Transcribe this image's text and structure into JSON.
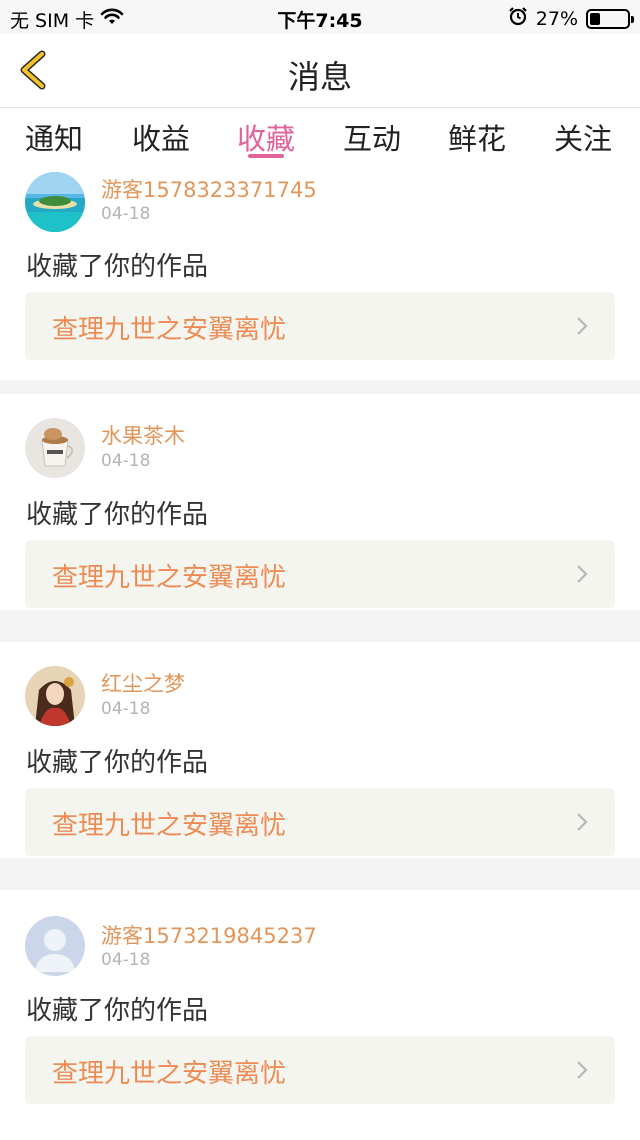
{
  "status_bar": {
    "carrier": "无 SIM 卡",
    "time": "下午7:45",
    "battery_text": "27%",
    "battery_level": 0.27
  },
  "nav": {
    "title": "消息"
  },
  "tabs": [
    {
      "label": "通知",
      "active": false
    },
    {
      "label": "收益",
      "active": false
    },
    {
      "label": "收藏",
      "active": true
    },
    {
      "label": "互动",
      "active": false
    },
    {
      "label": "鲜花",
      "active": false
    },
    {
      "label": "关注",
      "active": false
    }
  ],
  "items": [
    {
      "username": "游客1578323371745",
      "date": "04-18",
      "action": "收藏了你的作品",
      "work_title": "查理九世之安翼离忧",
      "avatar_icon": "beach-island-avatar"
    },
    {
      "username": "水果茶木",
      "date": "04-18",
      "action": "收藏了你的作品",
      "work_title": "查理九世之安翼离忧",
      "avatar_icon": "coffee-cup-avatar"
    },
    {
      "username": "红尘之梦",
      "date": "04-18",
      "action": "收藏了你的作品",
      "work_title": "查理九世之安翼离忧",
      "avatar_icon": "anime-girl-avatar"
    },
    {
      "username": "游客1573219845237",
      "date": "04-18",
      "action": "收藏了你的作品",
      "work_title": "查理九世之安翼离忧",
      "avatar_icon": "default-person-avatar"
    }
  ],
  "colors": {
    "accent": "#e1639a",
    "username": "#e2965a",
    "work_title": "#ee8b55",
    "back_arrow": "#f2b51e"
  }
}
